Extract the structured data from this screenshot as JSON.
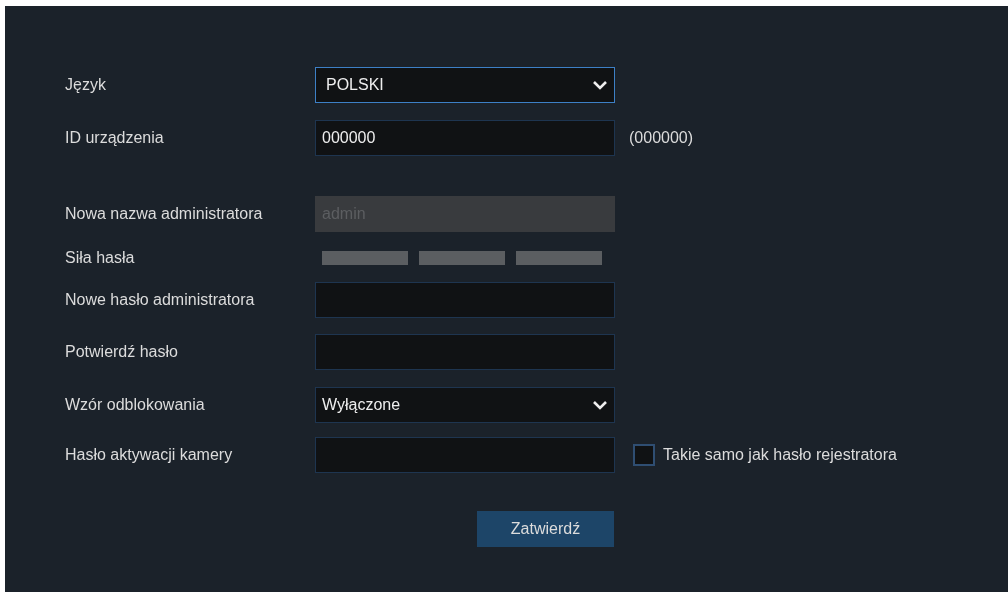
{
  "form": {
    "rows": [
      {
        "kind": "select",
        "label": "Język",
        "value": "POLSKI",
        "focused": true
      },
      {
        "kind": "text",
        "label": "ID urządzenia",
        "value": "000000",
        "note": "(000000)"
      },
      {
        "kind": "disabled",
        "label": "Nowa nazwa administratora",
        "placeholder": "admin"
      },
      {
        "kind": "strength",
        "label": "Siła hasła"
      },
      {
        "kind": "password",
        "label": "Nowe hasło administratora"
      },
      {
        "kind": "password",
        "label": "Potwierdź hasło"
      },
      {
        "kind": "select",
        "label": "Wzór odblokowania",
        "value": "Wyłączone",
        "focused": false
      },
      {
        "kind": "password",
        "label": "Hasło aktywacji kamery",
        "checkbox": {
          "label": "Takie samo jak hasło rejestratora",
          "checked": false
        }
      }
    ],
    "submit": "Zatwierdź"
  }
}
